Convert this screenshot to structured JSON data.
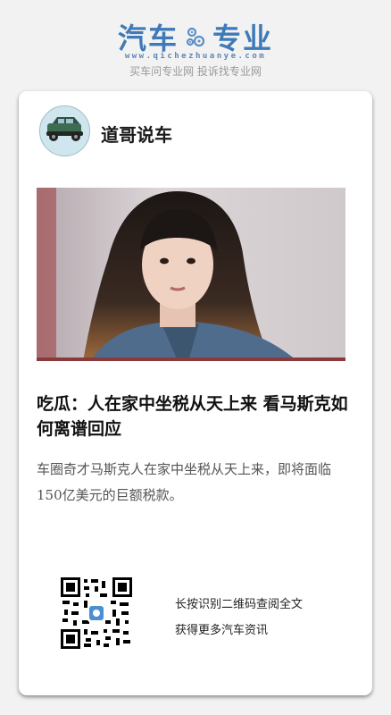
{
  "brand": {
    "logo_left": "汽车",
    "logo_right": "专业",
    "url": "www.qichezhuanye.com",
    "slogan": "买车问专业网 投诉找专业网",
    "color": "#3f7ab8"
  },
  "card": {
    "author": "道哥说车",
    "avatar_icon": "car-icon",
    "title": "吃瓜：人在家中坐税从天上来 看马斯克如何离谱回应",
    "summary": "车圈奇才马斯克人在家中坐税从天上来，即将面临150亿美元的巨额税款。",
    "cta_line1": "长按识别二维码查阅全文",
    "cta_line2": "获得更多汽车资讯",
    "qr_icon": "qr-code-icon"
  }
}
